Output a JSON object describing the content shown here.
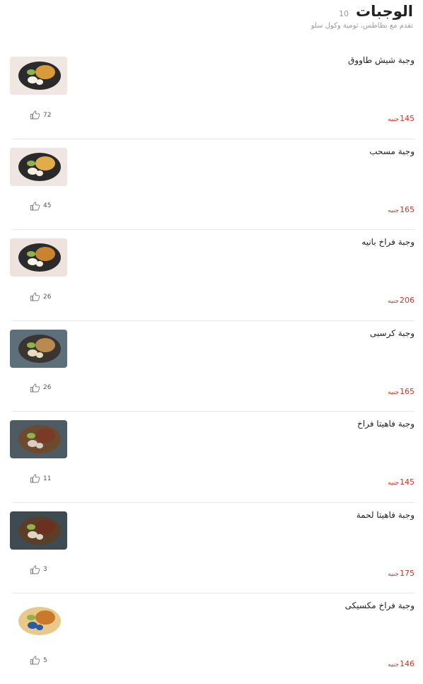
{
  "section": {
    "title": "الوجبات",
    "count": "10",
    "subtitle": "تقدم مع بطاطس، ثومية وكول سلو"
  },
  "currency": "جنيه",
  "icons": {
    "like": "thumbs-up-icon"
  },
  "colors": {
    "price": "#c0392b",
    "muted": "#9a9a9a",
    "divider": "#e6e6e6"
  },
  "items": [
    {
      "name": "وجبة شيش طاووق",
      "price": "145",
      "likes": "72"
    },
    {
      "name": "وجبة مسحب",
      "price": "165",
      "likes": "45"
    },
    {
      "name": "وجبة فراخ بانيه",
      "price": "206",
      "likes": "26"
    },
    {
      "name": "وجبة كرسبى",
      "price": "165",
      "likes": "26"
    },
    {
      "name": "وجبة فاهيتا فراخ",
      "price": "145",
      "likes": "11"
    },
    {
      "name": "وجبة فاهيتا لحمة",
      "price": "175",
      "likes": "3"
    },
    {
      "name": "وجبة فراخ مكسيكى",
      "price": "146",
      "likes": "5"
    }
  ]
}
